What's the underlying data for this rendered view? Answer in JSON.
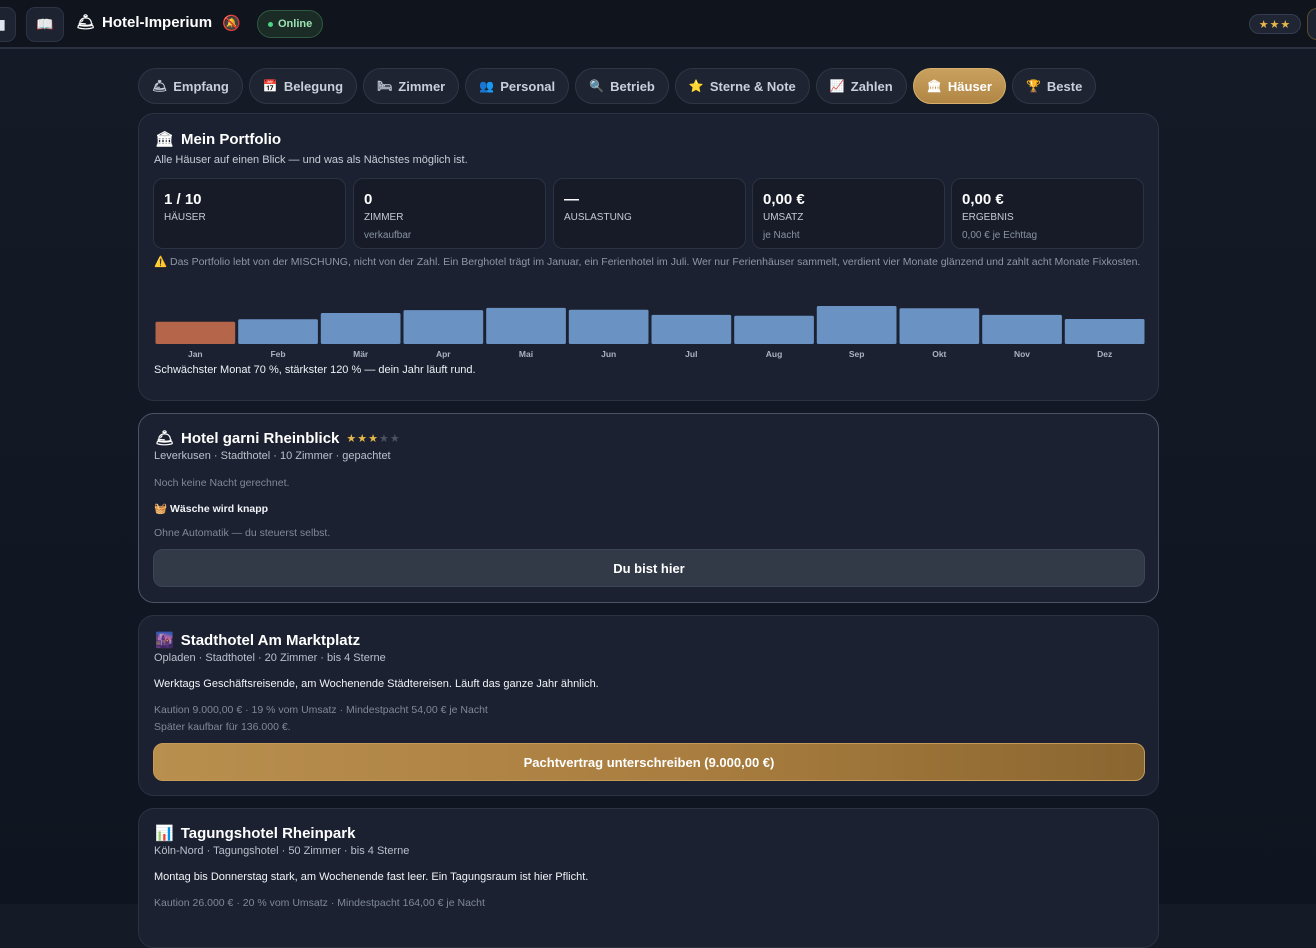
{
  "topbar": {
    "menu_icon": "menu-icon",
    "book_icon": "book-icon",
    "brand_icon": "hotel-bell-icon",
    "title": "Hotel-Imperium",
    "bell_icon": "notification-bell-icon",
    "status": "Online",
    "stars": "★★★"
  },
  "tabs": [
    {
      "icon": "🛎",
      "label": "Empfang"
    },
    {
      "icon": "📅",
      "label": "Belegung"
    },
    {
      "icon": "🛏",
      "label": "Zimmer"
    },
    {
      "icon": "👥",
      "label": "Personal"
    },
    {
      "icon": "🔍",
      "label": "Betrieb"
    },
    {
      "icon": "⭐",
      "label": "Sterne & Note"
    },
    {
      "icon": "📈",
      "label": "Zahlen"
    },
    {
      "icon": "🏛",
      "label": "Häuser"
    },
    {
      "icon": "🏆",
      "label": "Beste"
    }
  ],
  "active_tab": "Häuser",
  "portfolio": {
    "icon": "🏛",
    "title": "Mein Portfolio",
    "subtitle": "Alle Häuser auf einen Blick — und was als Nächstes möglich ist.",
    "stats": [
      {
        "value": "1 / 10",
        "label": "HÄUSER",
        "hint": ""
      },
      {
        "value": "0",
        "label": "ZIMMER",
        "hint": "verkaufbar"
      },
      {
        "value": "—",
        "label": "AUSLASTUNG",
        "hint": ""
      },
      {
        "value": "0,00 €",
        "label": "UMSATZ",
        "hint": "je Nacht"
      },
      {
        "value": "0,00 €",
        "label": "ERGEBNIS",
        "hint": "0,00 € je Echttag"
      }
    ],
    "warning_icon": "⚠️",
    "warning": "Das Portfolio lebt von der MISCHUNG, nicht von der Zahl. Ein Berghotel trägt im Januar, ein Ferienhotel im Juli. Wer nur Ferienhäuser sammelt, verdient vier Monate glänzend und zahlt acht Monate Fixkosten.",
    "chart_note": "Schwächster Monat 70 %, stärkster 120 % — dein Jahr läuft rund."
  },
  "chart_data": {
    "type": "bar",
    "categories": [
      "Jan",
      "Feb",
      "Mär",
      "Apr",
      "Mai",
      "Jun",
      "Jul",
      "Aug",
      "Sep",
      "Okt",
      "Nov",
      "Dez"
    ],
    "values": [
      70,
      78,
      98,
      107,
      114,
      108,
      92,
      89,
      120,
      113,
      92,
      79
    ],
    "ylim": [
      0,
      120
    ],
    "highlight_color": "#b5654a",
    "bar_color": "#6a93c4"
  },
  "hotels": [
    {
      "icon": "🛎",
      "name": "Hotel garni Rheinblick",
      "stars_on": "★★★",
      "stars_off": "★★",
      "meta": "Leverkusen · Stadthotel · 10 Zimmer · gepachtet",
      "note": "Noch keine Nacht gerechnet.",
      "alert_icon": "🧺",
      "alert": "Wäsche wird knapp",
      "automation": "Ohne Automatik — du steuerst selbst.",
      "button": "Du bist hier"
    },
    {
      "icon": "🌆",
      "name": "Stadthotel Am Marktplatz",
      "meta": "Opladen · Stadthotel · 20 Zimmer · bis 4 Sterne",
      "desc": "Werktags Geschäftsreisende, am Wochenende Städtereisen. Läuft das ganze Jahr ähnlich.",
      "terms": "Kaution 9.000,00 € · 19 % vom Umsatz · Mindestpacht 54,00 € je Nacht",
      "buy": "Später kaufbar für 136.000 €.",
      "button": "Pachtvertrag unterschreiben (9.000,00 €)"
    },
    {
      "icon": "📊",
      "name": "Tagungshotel Rheinpark",
      "meta": "Köln-Nord · Tagungshotel · 50 Zimmer · bis 4 Sterne",
      "desc": "Montag bis Donnerstag stark, am Wochenende fast leer. Ein Tagungsraum ist hier Pflicht.",
      "terms": "Kaution 26.000 € · 20 % vom Umsatz · Mindestpacht 164,00 € je Nacht"
    }
  ]
}
